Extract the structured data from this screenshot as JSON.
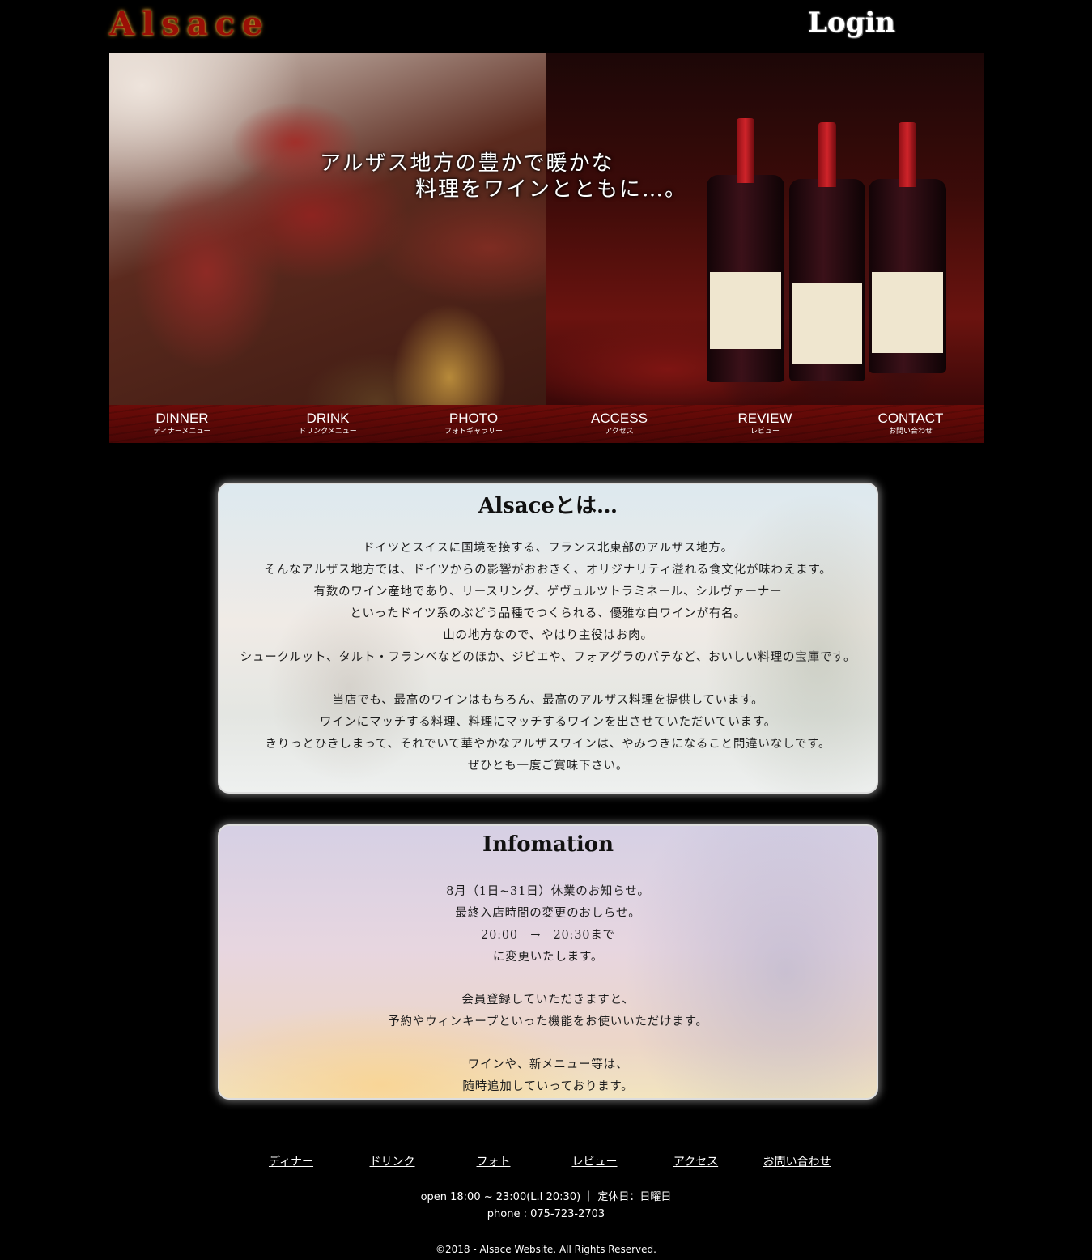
{
  "header": {
    "logo": "Alsace",
    "login": "Login"
  },
  "hero": {
    "line1": "アルザス地方の豊かで暖かな",
    "line2": "料理をワインとともに…。"
  },
  "nav": [
    {
      "en": "DINNER",
      "ja": "ディナーメニュー"
    },
    {
      "en": "DRINK",
      "ja": "ドリンクメニュー"
    },
    {
      "en": "PHOTO",
      "ja": "フォトギャラリー"
    },
    {
      "en": "ACCESS",
      "ja": "アクセス"
    },
    {
      "en": "REVIEW",
      "ja": "レビュー"
    },
    {
      "en": "CONTACT",
      "ja": "お問い合わせ"
    }
  ],
  "about": {
    "title": "Alsaceとは…",
    "lines": [
      "ドイツとスイスに国境を接する、フランス北東部のアルザス地方。",
      "そんなアルザス地方では、ドイツからの影響がおおきく、オリジナリティ溢れる食文化が味わえます。",
      "有数のワイン産地であり、リースリング、ゲヴュルツトラミネール、シルヴァーナー",
      "といったドイツ系のぶどう品種でつくられる、優雅な白ワインが有名。",
      "山の地方なので、やはり主役はお肉。",
      "シュークルット、タルト・フランベなどのほか、ジビエや、フォアグラのパテなど、おいしい料理の宝庫です。",
      "当店でも、最高のワインはもちろん、最高のアルザス料理を提供しています。",
      "ワインにマッチする料理、料理にマッチするワインを出させていただいています。",
      "きりっとひきしまって、それでいて華やかなアルザスワインは、やみつきになること間違いなしです。",
      "ぜひとも一度ご賞味下さい。"
    ]
  },
  "info": {
    "title": "Infomation",
    "lines": [
      "8月（1日~31日）休業のお知らせ。",
      "最終入店時間の変更のおしらせ。",
      "20:00　→　20:30まで",
      "に変更いたします。",
      "会員登録していただきますと、",
      "予約やウィンキープといった機能をお使いいただけます。",
      "ワインや、新メニュー等は、",
      "随時追加していっております。"
    ]
  },
  "footer": {
    "links": [
      "ディナー",
      "ドリンク",
      "フォト",
      "レビュー",
      "アクセス",
      "お問い合わせ"
    ],
    "hours": "open 18:00 ~ 23:00(L.I 20:30) ｜ 定休日：日曜日",
    "phone": "phone : 075-723-2703",
    "copyright": "©2018 - Alsace Website. All Rights Reserved."
  }
}
